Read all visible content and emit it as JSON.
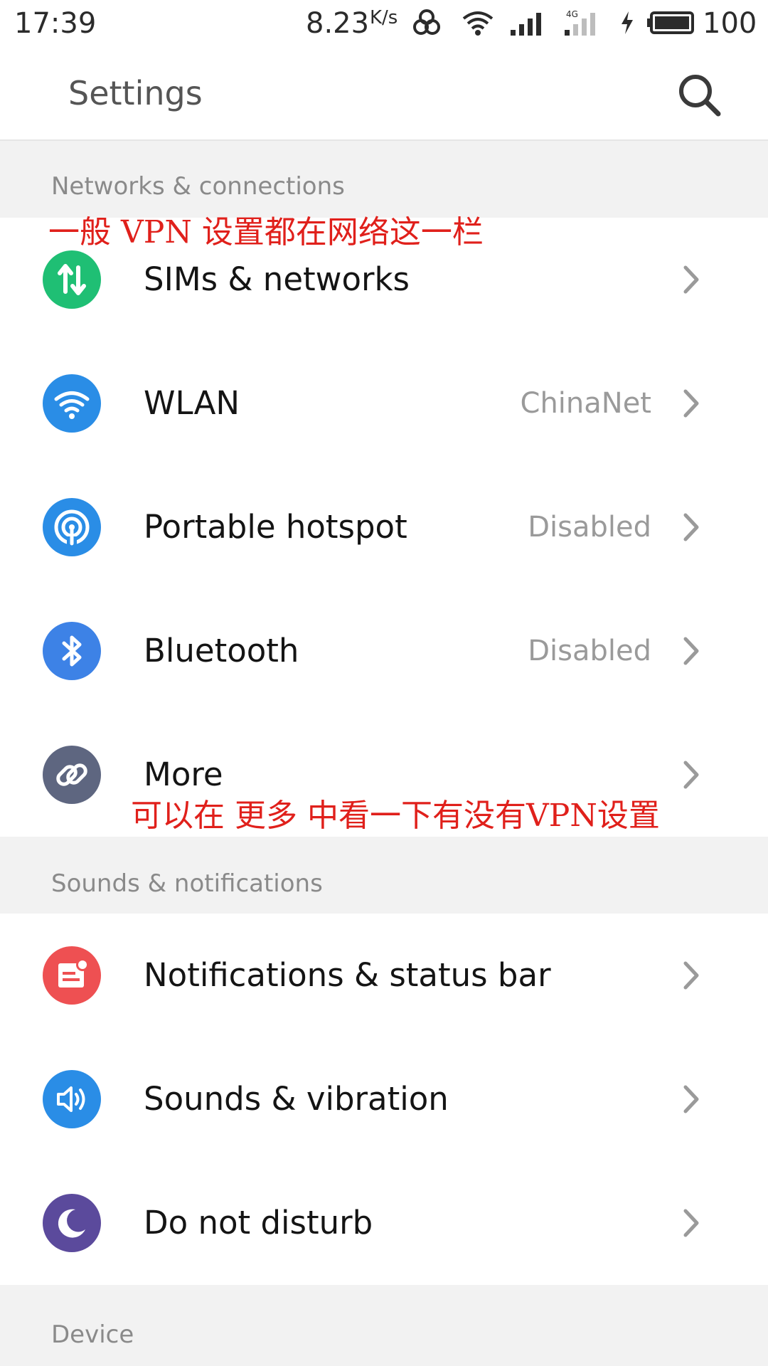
{
  "status_bar": {
    "time": "17:39",
    "speed": "8.23",
    "speed_unit": "K/s",
    "battery": "100",
    "icons": [
      "hotspot-link-icon",
      "wifi-icon",
      "signal-icon",
      "4g-signal-icon",
      "charging-icon",
      "battery-icon"
    ]
  },
  "header": {
    "title": "Settings",
    "search_icon": "search-icon"
  },
  "sections": {
    "networks": "Networks & connections",
    "sounds": "Sounds & notifications",
    "device": "Device"
  },
  "rows": {
    "sims": {
      "label": "SIMs & networks",
      "value": "",
      "icon": "sim-swap-icon",
      "color": "#1fbf74"
    },
    "wlan": {
      "label": "WLAN",
      "value": "ChinaNet",
      "icon": "wifi-icon",
      "color": "#2a8de6"
    },
    "hotspot": {
      "label": "Portable hotspot",
      "value": "Disabled",
      "icon": "hotspot-icon",
      "color": "#2a8de6"
    },
    "bluetooth": {
      "label": "Bluetooth",
      "value": "Disabled",
      "icon": "bluetooth-icon",
      "color": "#3d82e6"
    },
    "more": {
      "label": "More",
      "value": "",
      "icon": "link-icon",
      "color": "#5e6680"
    },
    "notifications": {
      "label": "Notifications & status bar",
      "value": "",
      "icon": "notification-icon",
      "color": "#ee5052"
    },
    "sounds": {
      "label": "Sounds & vibration",
      "value": "",
      "icon": "speaker-icon",
      "color": "#2a8de6"
    },
    "dnd": {
      "label": "Do not disturb",
      "value": "",
      "icon": "moon-icon",
      "color": "#5b4a9c"
    }
  },
  "annotations": {
    "network_note": "一般 VPN 设置都在网络这一栏",
    "more_note": "可以在 更多 中看一下有没有VPN设置"
  },
  "colors": {
    "annotation": "#e0201b",
    "section_bg": "#f2f2f2",
    "secondary_text": "#9a9a9a"
  }
}
